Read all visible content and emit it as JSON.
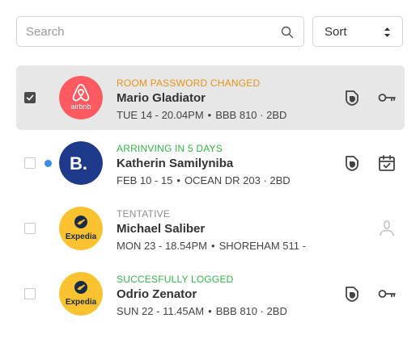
{
  "search": {
    "placeholder": "Search",
    "value": ""
  },
  "sort": {
    "label": "Sort"
  },
  "colors": {
    "orange": "#e39417",
    "green": "#35b24a",
    "gray": "#8c8c8c",
    "airbnb": "#ff5a5f",
    "booking": "#1f3a8a",
    "expedia": "#f9c22e",
    "dot": "#3a8ee6"
  },
  "rows": [
    {
      "status": "ROOM PASSWORD CHANGED",
      "status_color": "#e39417",
      "name": "Mario Gladiator",
      "date": "TUE 14 - 20.04PM",
      "location": "BBB 810 · 2BD",
      "logo": "airbnb-logo",
      "logo_text": "airbnb",
      "checked": true,
      "unread": false,
      "actions": [
        "shield-icon",
        "key-icon"
      ]
    },
    {
      "status": "ARRINVING IN 5 DAYS",
      "status_color": "#35b24a",
      "name": "Katherin Samilyniba",
      "date": "FEB 10 - 15",
      "location": "OCEAN DR 203 · 2BD",
      "logo": "booking-logo",
      "logo_text": "B.",
      "checked": false,
      "unread": true,
      "actions": [
        "shield-icon",
        "calendar-check-icon"
      ]
    },
    {
      "status": "TENTATIVE",
      "status_color": "#8c8c8c",
      "name": "Michael Saliber",
      "date": "MON 23 - 18.54PM",
      "location": "SHOREHAM 511 -",
      "logo": "expedia-logo",
      "logo_text": "Expedia",
      "checked": false,
      "unread": false,
      "actions": [
        "user-icon"
      ]
    },
    {
      "status": "SUCCESFULLY LOGGED",
      "status_color": "#35b24a",
      "name": "Odrio Zenator",
      "date": "SUN 22 - 11.45AM",
      "location": "BBB 810 · 2BD",
      "logo": "expedia-logo",
      "logo_text": "Expedia",
      "checked": false,
      "unread": false,
      "actions": [
        "shield-icon",
        "key-icon"
      ]
    }
  ]
}
